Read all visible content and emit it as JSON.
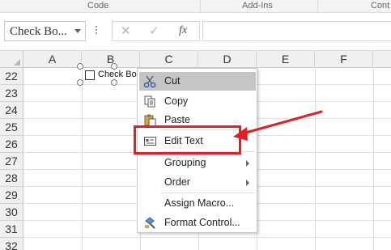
{
  "ribbon": {
    "groups": [
      {
        "label": "Code"
      },
      {
        "label": "Add-Ins"
      },
      {
        "label": "Cont"
      }
    ]
  },
  "formula_bar": {
    "name_box_value": "Check Bo...",
    "cancel_glyph": "✕",
    "enter_glyph": "✓",
    "function_glyph": "fx",
    "formula_value": ""
  },
  "sheet": {
    "columns": [
      "A",
      "B",
      "C",
      "D",
      "E",
      "F"
    ],
    "rows": [
      "22",
      "23",
      "24",
      "25",
      "26",
      "27",
      "28",
      "29",
      "30",
      "31",
      "32"
    ]
  },
  "control": {
    "label": "Check Box"
  },
  "context_menu": {
    "items": [
      {
        "label": "Cut",
        "icon": "scissors-icon",
        "highlighted": true
      },
      {
        "label": "Copy",
        "icon": "copy-icon"
      },
      {
        "label": "Paste",
        "icon": "paste-icon"
      },
      {
        "label": "Edit Text",
        "icon": "edit-text-icon"
      },
      {
        "label": "Grouping",
        "submenu": true
      },
      {
        "label": "Order",
        "submenu": true
      },
      {
        "label": "Assign Macro..."
      },
      {
        "label": "Format Control...",
        "icon": "format-control-icon"
      }
    ]
  },
  "annotation": {
    "color": "#e31e25"
  }
}
